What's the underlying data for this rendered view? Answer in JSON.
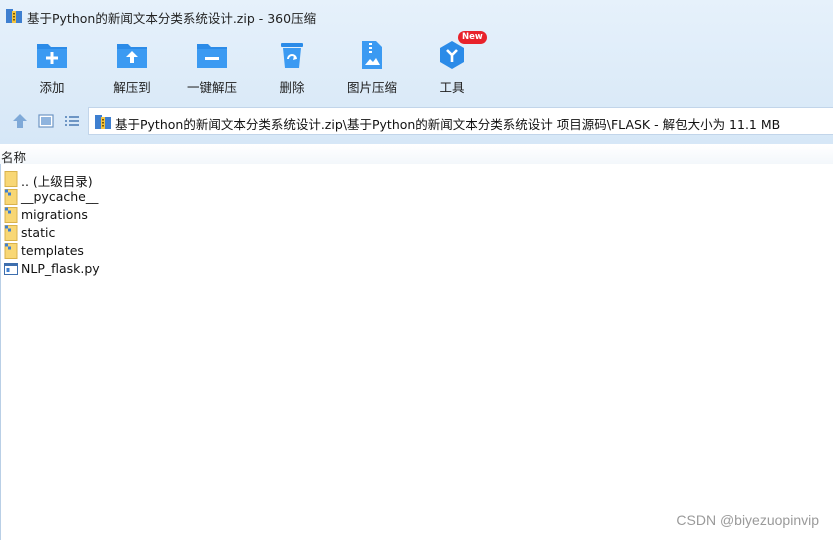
{
  "window": {
    "title": "基于Python的新闻文本分类系统设计.zip - 360压缩"
  },
  "toolbar": {
    "items": [
      {
        "label": "添加",
        "icon": "add-folder-icon"
      },
      {
        "label": "解压到",
        "icon": "extract-to-icon"
      },
      {
        "label": "一键解压",
        "icon": "one-click-extract-icon"
      },
      {
        "label": "删除",
        "icon": "recycle-bin-icon"
      },
      {
        "label": "图片压缩",
        "icon": "image-compress-icon"
      },
      {
        "label": "工具",
        "icon": "tools-icon",
        "badge": "New"
      }
    ]
  },
  "nav": {
    "up_icon": "arrow-up-icon",
    "view_icon": "view-mode-icon",
    "list_icon": "list-view-icon",
    "address": "基于Python的新闻文本分类系统设计.zip\\基于Python的新闻文本分类系统设计 项目源码\\FLASK - 解包大小为 11.1 MB"
  },
  "columns": {
    "name": "名称"
  },
  "files": [
    {
      "name": ".. (上级目录)",
      "type": "parent-folder"
    },
    {
      "name": "__pycache__",
      "type": "folder"
    },
    {
      "name": "migrations",
      "type": "folder"
    },
    {
      "name": "static",
      "type": "folder"
    },
    {
      "name": "templates",
      "type": "folder"
    },
    {
      "name": "NLP_flask.py",
      "type": "python-file"
    }
  ],
  "watermark": "CSDN @biyezuopinvip",
  "colors": {
    "accent": "#2b8be8",
    "badge": "#e8222b",
    "folder": "#f8d775"
  }
}
